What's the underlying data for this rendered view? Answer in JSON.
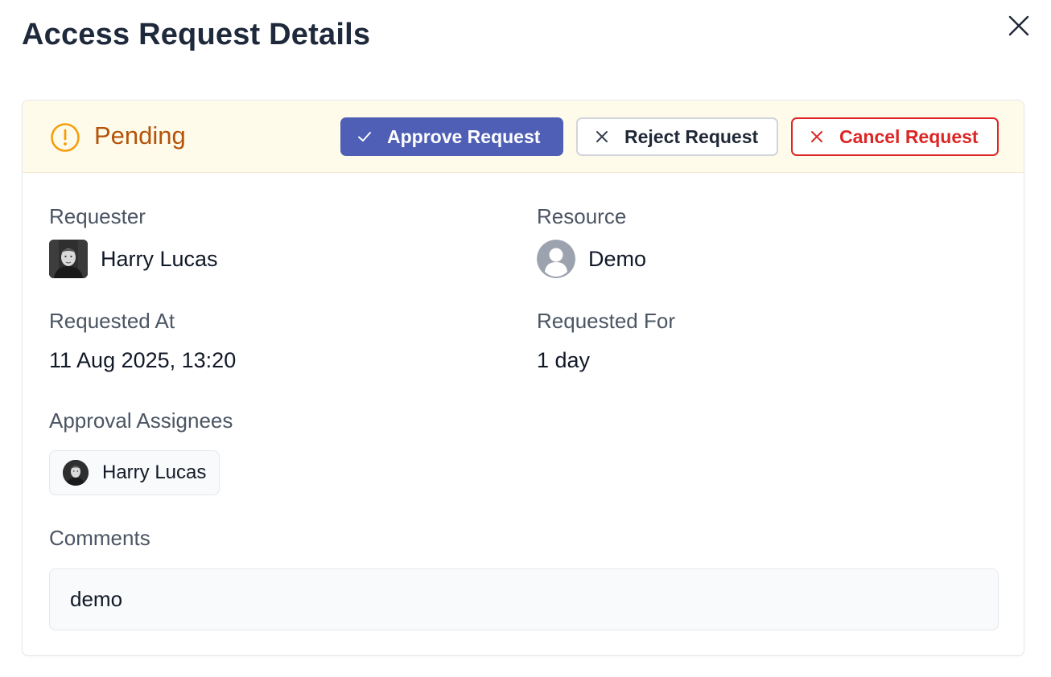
{
  "modal": {
    "title": "Access Request Details",
    "close_icon": "close-icon"
  },
  "status": {
    "label": "Pending",
    "icon": "exclamation-circle-icon",
    "color": "#b45309",
    "icon_color": "#f59e0b",
    "bar_background": "#fffbeb"
  },
  "actions": {
    "approve": {
      "label": "Approve Request",
      "icon": "check-icon",
      "background": "#4f5fb5"
    },
    "reject": {
      "label": "Reject Request",
      "icon": "x-icon"
    },
    "cancel": {
      "label": "Cancel Request",
      "icon": "x-icon",
      "color": "#dc2626"
    }
  },
  "details": {
    "requester": {
      "label": "Requester",
      "name": "Harry Lucas",
      "avatar": "user-photo-avatar"
    },
    "resource": {
      "label": "Resource",
      "name": "Demo",
      "avatar": "default-user-avatar"
    },
    "requested_at": {
      "label": "Requested At",
      "value": "11 Aug 2025, 13:20"
    },
    "requested_for": {
      "label": "Requested For",
      "value": "1 day"
    },
    "approval_assignees": {
      "label": "Approval Assignees",
      "assignees": [
        {
          "name": "Harry Lucas",
          "avatar": "user-photo-avatar"
        }
      ]
    },
    "comments": {
      "label": "Comments",
      "value": "demo"
    }
  }
}
